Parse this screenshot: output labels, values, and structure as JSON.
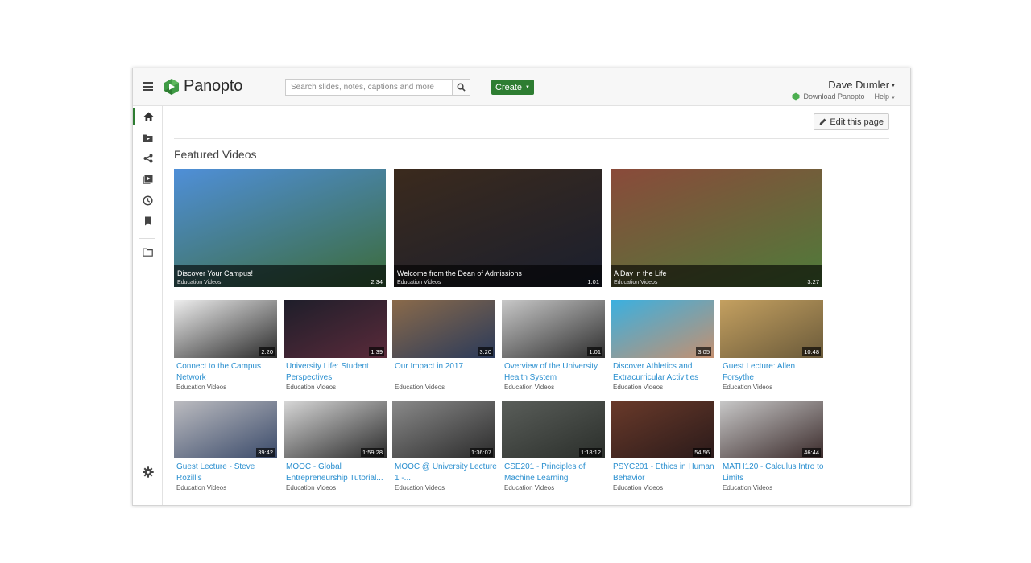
{
  "header": {
    "app_name": "Panopto",
    "search_placeholder": "Search slides, notes, captions and more",
    "create_label": "Create",
    "user_name": "Dave Dumler",
    "download_label": "Download Panopto",
    "help_label": "Help"
  },
  "sidebar": {
    "items": [
      {
        "name": "home-icon",
        "active": true
      },
      {
        "name": "folder-video-icon"
      },
      {
        "name": "share-icon"
      },
      {
        "name": "playlist-icon"
      },
      {
        "name": "clock-icon"
      },
      {
        "name": "bookmark-icon"
      },
      {
        "name": "folder-icon"
      }
    ]
  },
  "main": {
    "edit_label": "Edit this page",
    "section_title": "Featured Videos"
  },
  "featured": [
    {
      "title": "Discover Your Campus!",
      "folder": "Education Videos",
      "duration": "2:34",
      "colors": [
        "#4f8fd8",
        "#3c6b3a"
      ]
    },
    {
      "title": "Welcome from the Dean of Admissions",
      "folder": "Education Videos",
      "duration": "1:01",
      "colors": [
        "#3b2a1d",
        "#1a1f2e"
      ]
    },
    {
      "title": "A Day in the Life",
      "folder": "Education Videos",
      "duration": "3:27",
      "colors": [
        "#8a4a3a",
        "#4e7c3a"
      ]
    }
  ],
  "videos": [
    {
      "title": "Connect to the Campus Network",
      "folder": "Education Videos",
      "duration": "2:20",
      "colors": [
        "#eeeeee",
        "#2a2a2a"
      ]
    },
    {
      "title": "University Life: Student Perspectives",
      "folder": "Education Videos",
      "duration": "1:39",
      "colors": [
        "#1e1e2a",
        "#5a2a3a"
      ]
    },
    {
      "title": "Our Impact in 2017",
      "folder": "Education Videos",
      "duration": "3:20",
      "colors": [
        "#8a6a4a",
        "#2a3a5a"
      ]
    },
    {
      "title": "Overview of the University Health System",
      "folder": "Education Videos",
      "duration": "1:01",
      "colors": [
        "#c8c8c8",
        "#2e2e2e"
      ]
    },
    {
      "title": "Discover Athletics and Extracurricular Activities",
      "folder": "Education Videos",
      "duration": "3:05",
      "colors": [
        "#3ab0e0",
        "#c49070"
      ]
    },
    {
      "title": "Guest Lecture: Allen Forsythe",
      "folder": "Education Videos",
      "duration": "10:48",
      "colors": [
        "#c4a060",
        "#6a5a3a"
      ]
    },
    {
      "title": "Guest Lecture - Steve Rozillis",
      "folder": "Education Videos",
      "duration": "39:42",
      "colors": [
        "#bcbcc0",
        "#3a4a6a"
      ]
    },
    {
      "title": "MOOC - Global Entrepreneurship Tutorial...",
      "folder": "Education Videos",
      "duration": "1:59:28",
      "colors": [
        "#d8d8d8",
        "#2a2a2a"
      ]
    },
    {
      "title": "MOOC @ University Lecture 1 -...",
      "folder": "Education Videos",
      "duration": "1:36:07",
      "colors": [
        "#8a8a8a",
        "#2a2a2a"
      ]
    },
    {
      "title": "CSE201 - Principles of Machine Learning",
      "folder": "Education Videos",
      "duration": "1:18:12",
      "colors": [
        "#5a5e5a",
        "#2a2e2a"
      ]
    },
    {
      "title": "PSYC201 - Ethics in Human Behavior",
      "folder": "Education Videos",
      "duration": "54:56",
      "colors": [
        "#6a3a2a",
        "#2a1a1a"
      ]
    },
    {
      "title": "MATH120 - Calculus Intro to Limits",
      "folder": "Education Videos",
      "duration": "46:44",
      "colors": [
        "#c8c8c8",
        "#3a2a2a"
      ]
    }
  ],
  "colors": {
    "accent": "#2e7d32",
    "link": "#2a8fcf"
  }
}
